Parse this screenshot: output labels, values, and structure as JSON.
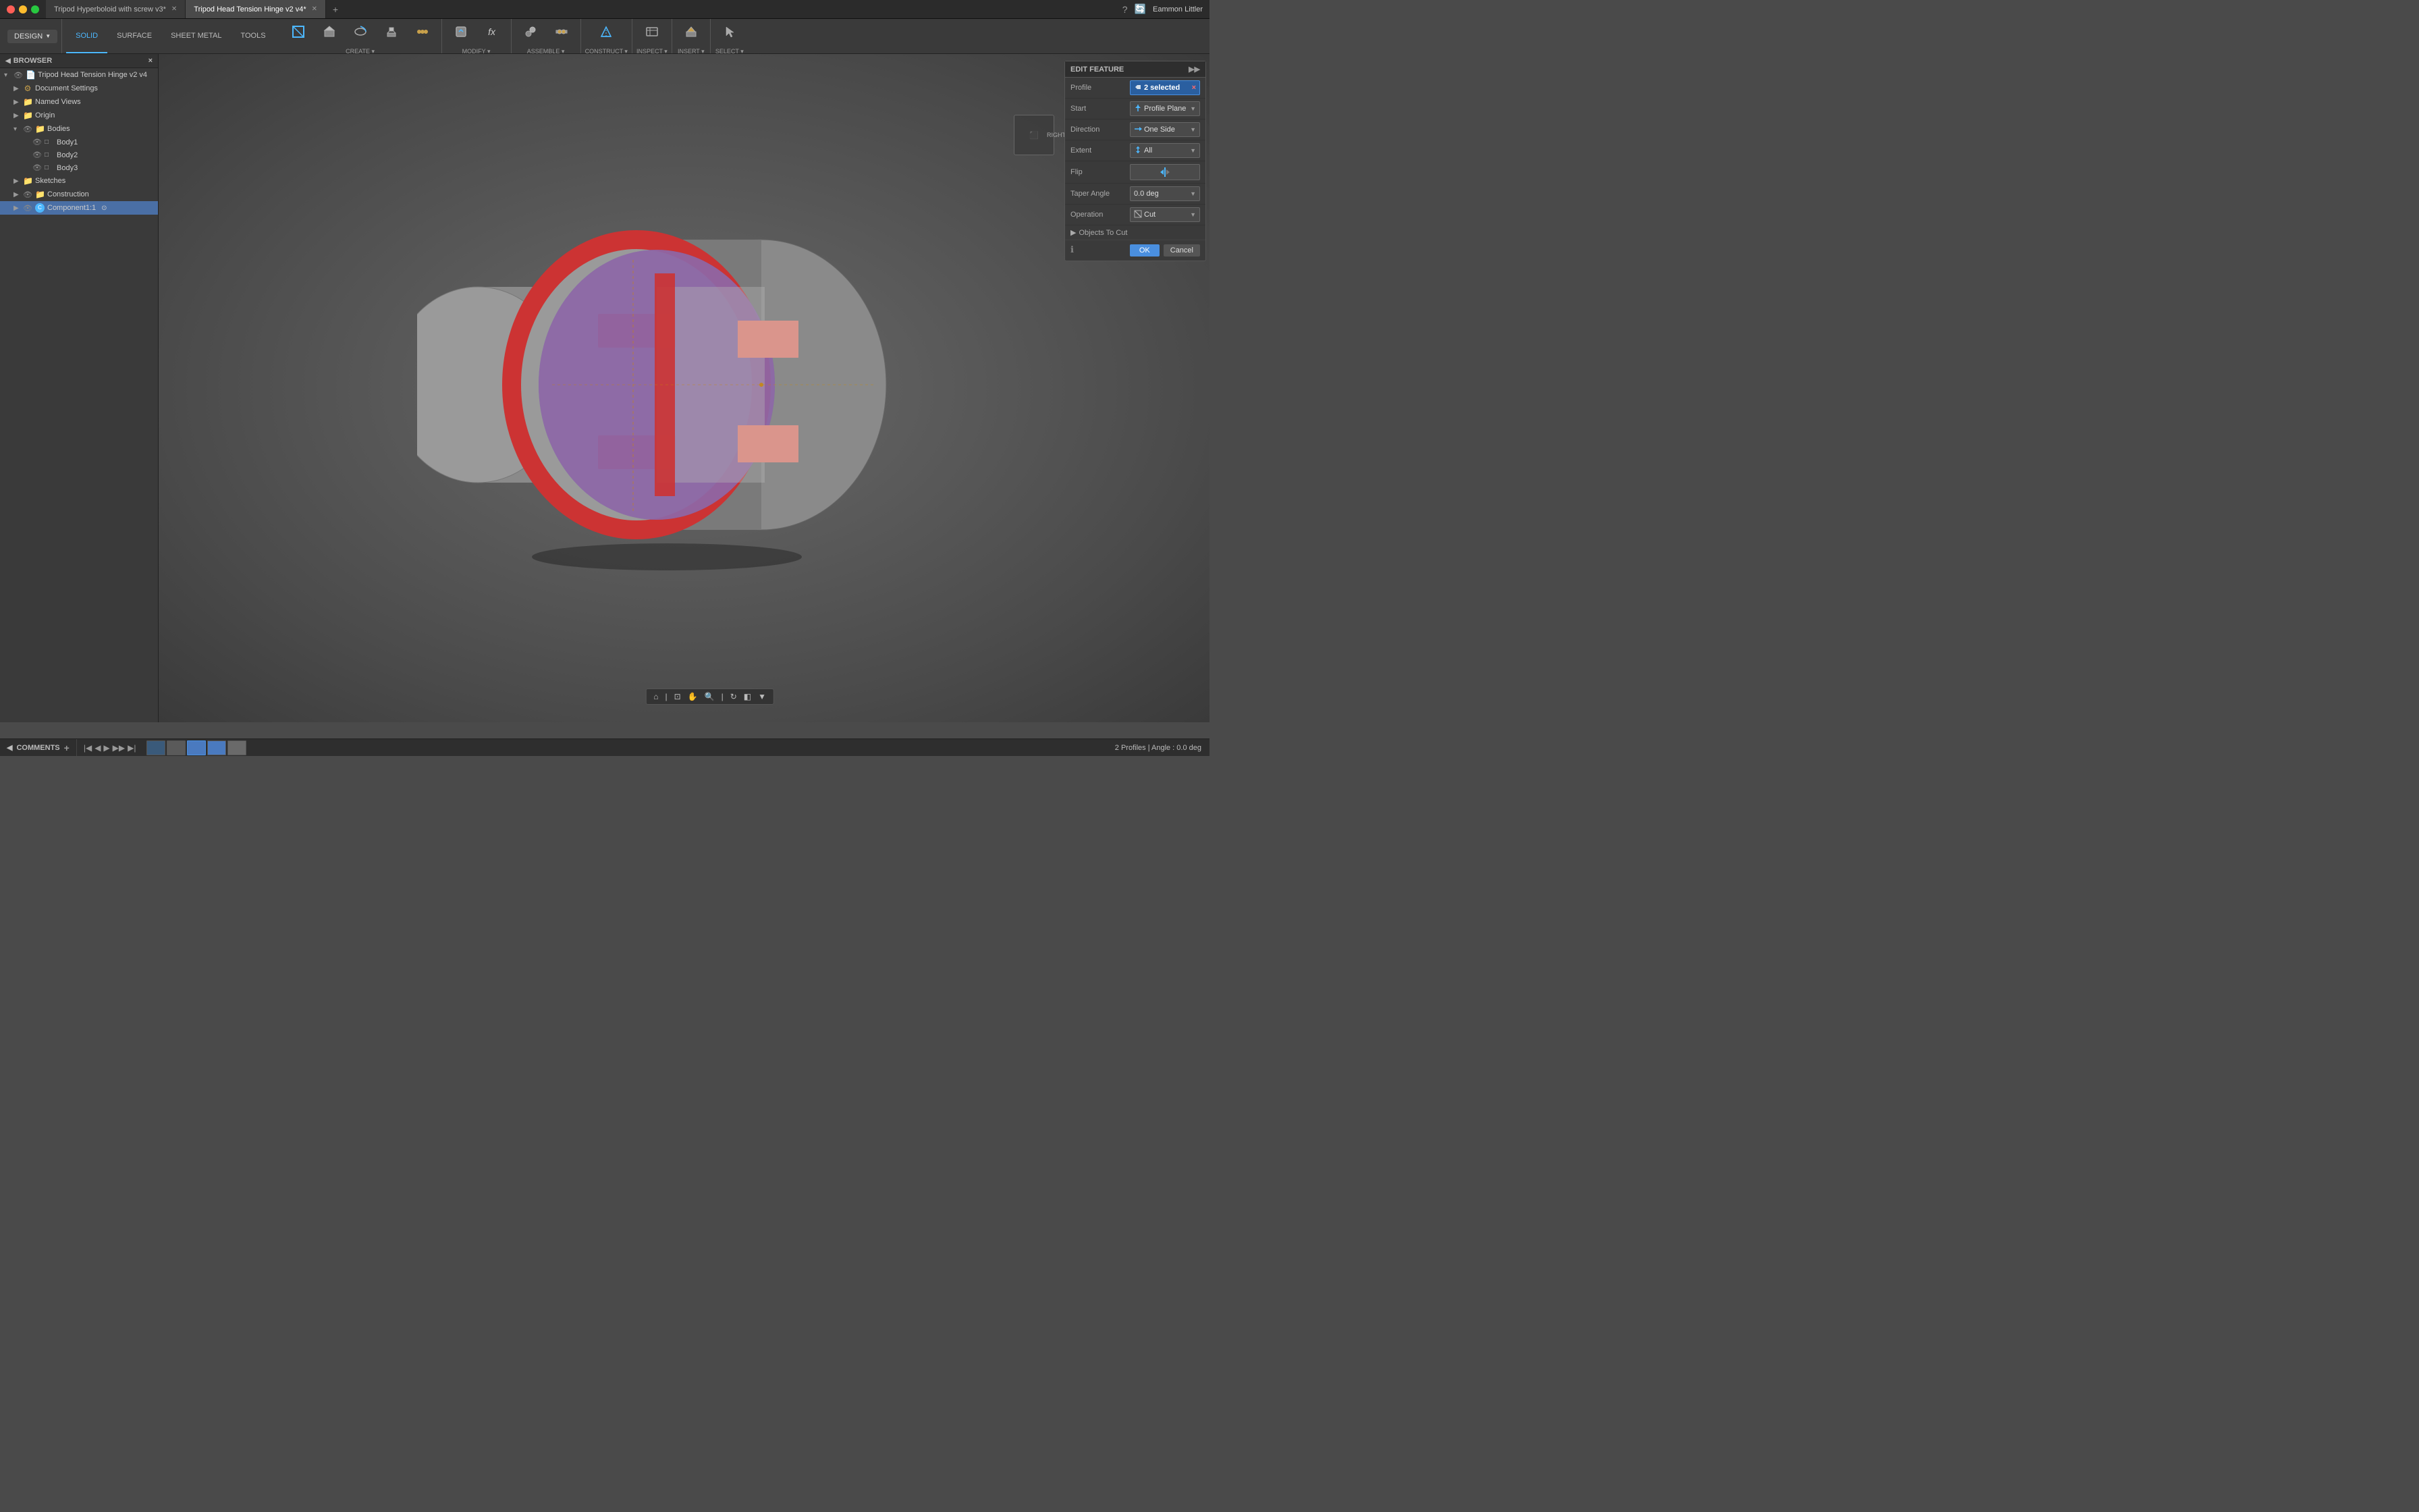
{
  "titlebar": {
    "tab1": "Tripod Hyperboloid with screw v3*",
    "tab2": "Tripod Head Tension Hinge v2 v4*",
    "user": "Eammon Littler"
  },
  "toolbar": {
    "design_label": "DESIGN",
    "tabs": [
      "SOLID",
      "SURFACE",
      "SHEET METAL",
      "TOOLS"
    ],
    "active_tab": "SOLID",
    "groups": [
      {
        "label": "CREATE",
        "tools": [
          {
            "icon": "⬡",
            "label": ""
          },
          {
            "icon": "◼",
            "label": ""
          },
          {
            "icon": "⭕",
            "label": ""
          },
          {
            "icon": "⬟",
            "label": ""
          },
          {
            "icon": "✦",
            "label": ""
          }
        ]
      },
      {
        "label": "MODIFY",
        "tools": [
          {
            "icon": "⬡",
            "label": ""
          },
          {
            "icon": "fx",
            "label": ""
          }
        ]
      },
      {
        "label": "ASSEMBLE",
        "tools": [
          {
            "icon": "⚙",
            "label": ""
          },
          {
            "icon": "🔩",
            "label": ""
          }
        ]
      },
      {
        "label": "CONSTRUCT",
        "tools": [
          {
            "icon": "📐",
            "label": ""
          }
        ]
      },
      {
        "label": "INSPECT",
        "tools": [
          {
            "icon": "🔍",
            "label": ""
          }
        ]
      },
      {
        "label": "INSERT",
        "tools": [
          {
            "icon": "⤵",
            "label": ""
          }
        ]
      },
      {
        "label": "SELECT",
        "tools": [
          {
            "icon": "↖",
            "label": ""
          }
        ]
      }
    ]
  },
  "browser": {
    "title": "BROWSER",
    "items": [
      {
        "level": 0,
        "label": "Tripod Head Tension Hinge v2 v4",
        "type": "file",
        "expanded": true
      },
      {
        "level": 1,
        "label": "Document Settings",
        "type": "settings"
      },
      {
        "level": 1,
        "label": "Named Views",
        "type": "folder"
      },
      {
        "level": 1,
        "label": "Origin",
        "type": "folder"
      },
      {
        "level": 1,
        "label": "Bodies",
        "type": "folder",
        "expanded": true
      },
      {
        "level": 2,
        "label": "Body1",
        "type": "body"
      },
      {
        "level": 2,
        "label": "Body2",
        "type": "body"
      },
      {
        "level": 2,
        "label": "Body3",
        "type": "body"
      },
      {
        "level": 1,
        "label": "Sketches",
        "type": "folder"
      },
      {
        "level": 1,
        "label": "Construction",
        "type": "folder"
      },
      {
        "level": 1,
        "label": "Component1:1",
        "type": "component"
      }
    ]
  },
  "editFeature": {
    "title": "EDIT FEATURE",
    "rows": [
      {
        "label": "Profile",
        "value": "2 selected",
        "type": "blue",
        "hasX": true
      },
      {
        "label": "Start",
        "value": "Profile Plane",
        "type": "select",
        "icon": "▶"
      },
      {
        "label": "Direction",
        "value": "One Side",
        "type": "select",
        "icon": "◀"
      },
      {
        "label": "Extent",
        "value": "All",
        "type": "select",
        "icon": "↕"
      },
      {
        "label": "Flip",
        "value": "",
        "type": "icon"
      },
      {
        "label": "Taper Angle",
        "value": "0.0 deg",
        "type": "select"
      },
      {
        "label": "Operation",
        "value": "Cut",
        "type": "select",
        "icon": "✂"
      }
    ],
    "objectsToCut": "Objects To Cut",
    "ok": "OK",
    "cancel": "Cancel"
  },
  "statusbar": {
    "comments": "COMMENTS",
    "statusRight": "2 Profiles | Angle : 0.0 deg"
  },
  "viewcube": {
    "label": "RIGHT"
  }
}
